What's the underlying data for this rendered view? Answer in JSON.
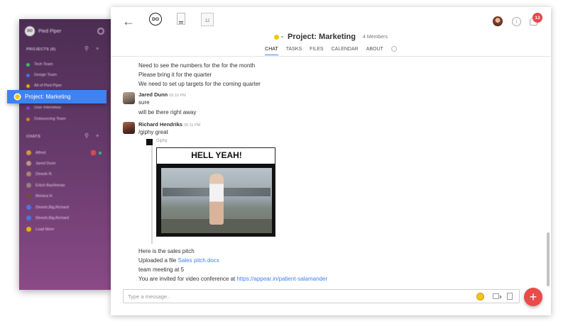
{
  "sidebar": {
    "team_name": "Pied Piper",
    "team_logo": "DO",
    "projects_header": "PROJECTS (6)",
    "projects": [
      {
        "label": "Tech Team",
        "color": "#3ecf6c"
      },
      {
        "label": "Design Team",
        "color": "#4a7bef"
      },
      {
        "label": "All of Pied Piper",
        "color": "#f5c400"
      },
      {
        "label": "Project: Marketing",
        "color": "#f5c400"
      },
      {
        "label": "User Interviews",
        "color": "#9b3de0"
      },
      {
        "label": "Outsourcing Team",
        "color": "#f08a24"
      }
    ],
    "active_project": "Project: Marketing",
    "chats_header": "CHATS",
    "chats": [
      {
        "label": "Alfred",
        "color": "#e8a236"
      },
      {
        "label": "Jared Dunn",
        "color": "#c9a083"
      },
      {
        "label": "Dinesh R.",
        "color": "#b78c70"
      },
      {
        "label": "Erlich Bachhman",
        "color": "#9a8a80"
      },
      {
        "label": "Monica H.",
        "color": "#7b4a38"
      },
      {
        "label": "Dinesh,Big,Richard",
        "color": "#4a7bef"
      },
      {
        "label": "Dinesh,Big,Richard",
        "color": "#4a7bef"
      },
      {
        "label": "Load More",
        "color": "#f5c400"
      }
    ]
  },
  "toolbar": {
    "back_icon": "arrow-left-icon",
    "app_logo": "DO",
    "calendar_day": "12",
    "notification_count": "13"
  },
  "channel": {
    "title": "Project: Marketing",
    "members": "4 Members",
    "status_color": "#f5c400"
  },
  "tabs": [
    "CHAT",
    "TASKS",
    "FILES",
    "CALENDAR",
    "ABOUT"
  ],
  "active_tab": "CHAT",
  "messages": {
    "intro_lines": [
      "Need to see the numbers for the for the month",
      "Please bring it for the quarter",
      "We need to set up targets for the coming quarter"
    ],
    "jared": {
      "author": "Jared Dunn",
      "time": "05:10 PM",
      "lines": [
        "sure",
        "will be there right away"
      ]
    },
    "richard": {
      "author": "Richard Hendriks",
      "time": "05:11 PM",
      "command": "/giphy great",
      "giphy_label": "Giphy",
      "gif_caption": "HELL YEAH!"
    },
    "tail": {
      "line1": "Here is the sales pitch",
      "line2_prefix": "Uploaded a file",
      "line2_file": "Sales pitch.docx",
      "line3": "team meeting at 5",
      "line4_prefix": "You are invited for video conference at",
      "line4_link": "https://appear.in/patient-salamander"
    }
  },
  "composer": {
    "placeholder": "Type a message..",
    "value": ""
  },
  "colors": {
    "accent": "#3f82f2",
    "fab": "#ea4a4a",
    "badge": "#e8474b"
  }
}
